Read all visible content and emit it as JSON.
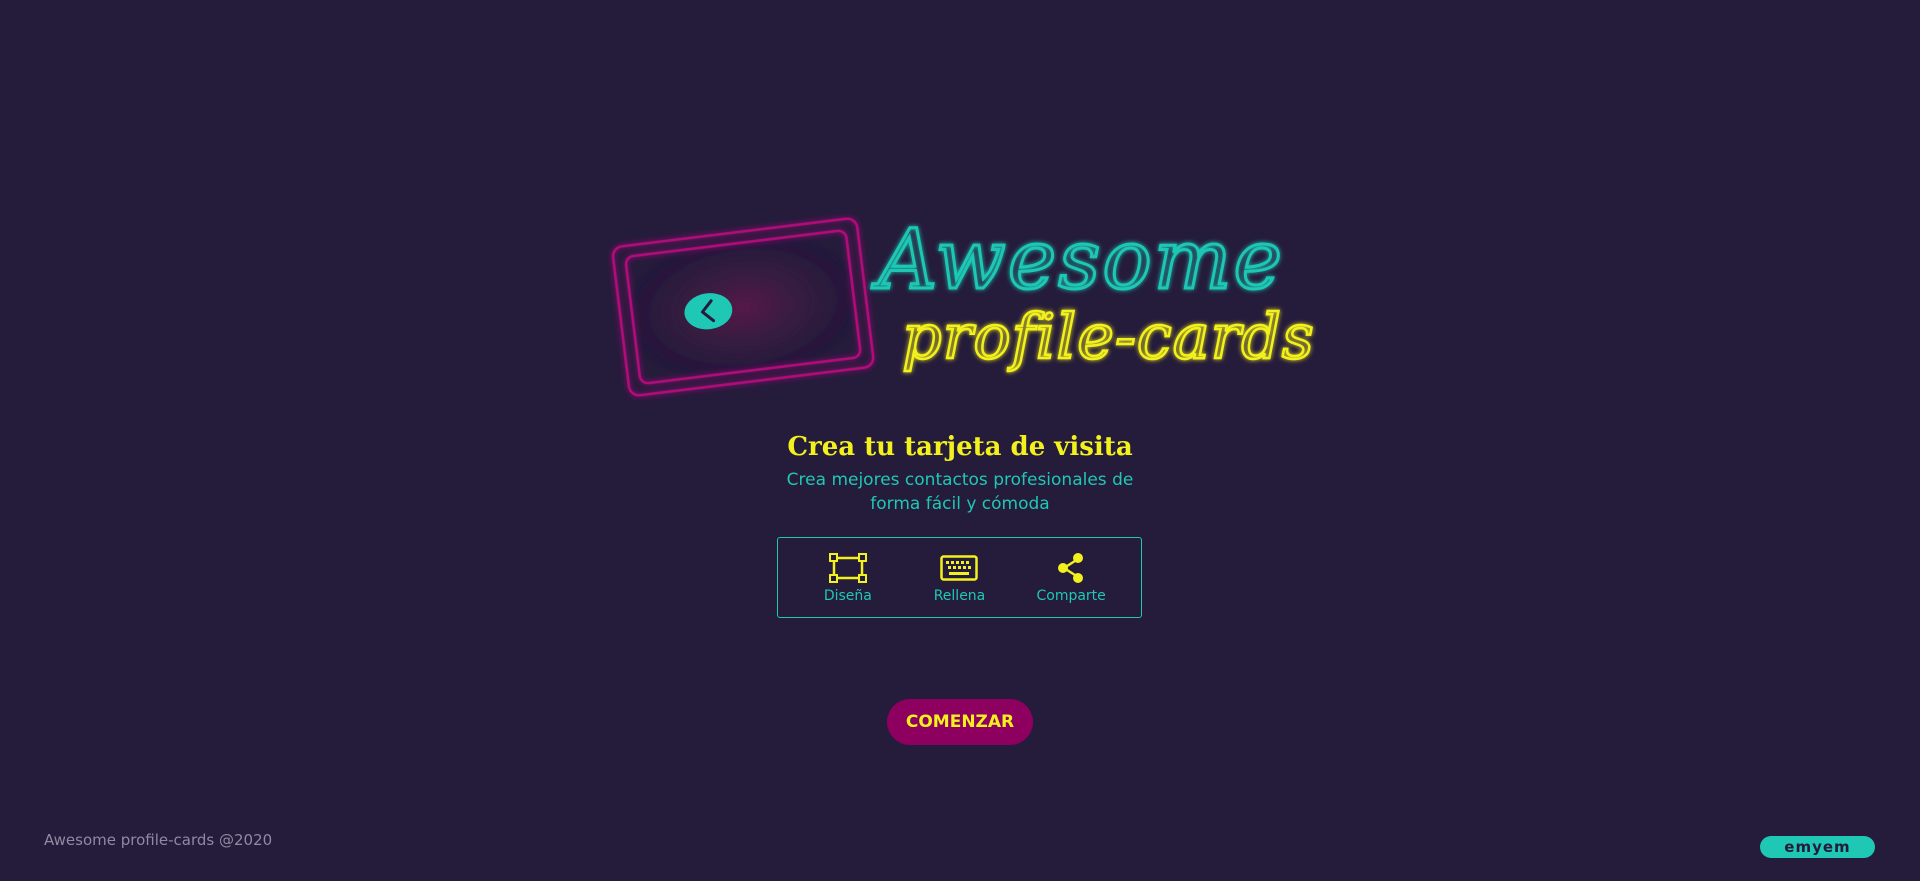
{
  "colors": {
    "background": "#251b3b",
    "accent_teal": "#1ec8b4",
    "accent_yellow": "#f3f11d",
    "accent_magenta": "#8d005f",
    "footer_text": "#8f8aa0"
  },
  "logo": {
    "title_line1": "Awesome",
    "title_line2": "profile-cards",
    "card_icon": "neon-card-icon"
  },
  "hero": {
    "title": "Crea tu tarjeta de visita",
    "subtitle": "Crea mejores contactos profesionales de forma fácil y cómoda"
  },
  "steps": [
    {
      "icon": "design-icon",
      "label": "Diseña"
    },
    {
      "icon": "keyboard-icon",
      "label": "Rellena"
    },
    {
      "icon": "share-icon",
      "label": "Comparte"
    }
  ],
  "cta": {
    "label": "COMENZAR"
  },
  "footer": {
    "copyright": "Awesome profile-cards @2020",
    "brand": "emyem"
  }
}
